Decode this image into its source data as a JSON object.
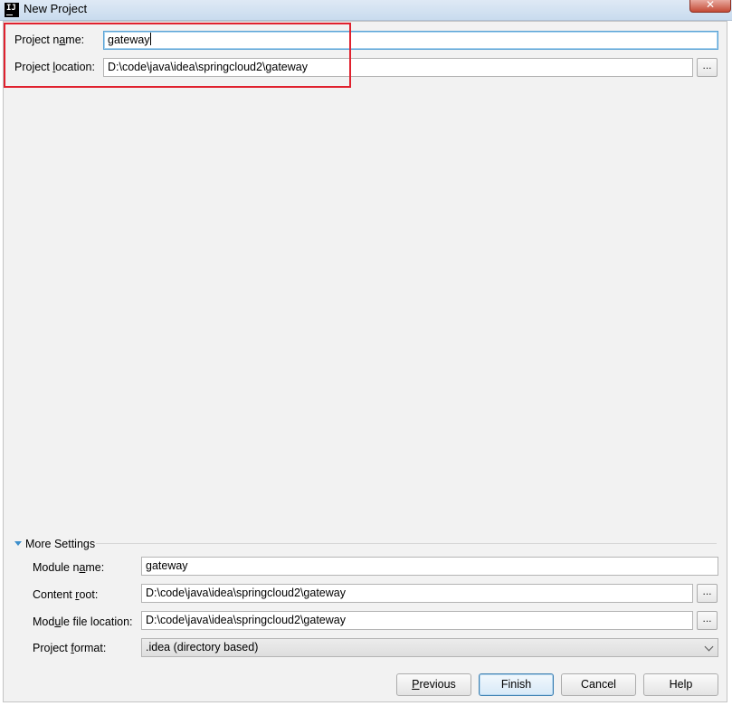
{
  "window": {
    "title": "New Project",
    "app_icon_label": "IJ",
    "close_symbol": "✕"
  },
  "project": {
    "name_label_pre": "Project n",
    "name_label_mn": "a",
    "name_label_post": "me:",
    "name_value": "gateway",
    "location_label_pre": "Project ",
    "location_label_mn": "l",
    "location_label_post": "ocation:",
    "location_value": "D:\\code\\java\\idea\\springcloud2\\gateway",
    "browse_label": "..."
  },
  "more_settings": {
    "title": "More Settings",
    "module_name_label_pre": "Module n",
    "module_name_label_mn": "a",
    "module_name_label_post": "me:",
    "module_name_value": "gateway",
    "content_root_label_pre": "Content ",
    "content_root_label_mn": "r",
    "content_root_label_post": "oot:",
    "content_root_value": "D:\\code\\java\\idea\\springcloud2\\gateway",
    "module_file_label_pre": "Mod",
    "module_file_label_mn": "u",
    "module_file_label_post": "le file location:",
    "module_file_value": "D:\\code\\java\\idea\\springcloud2\\gateway",
    "project_format_label_pre": "Project ",
    "project_format_label_mn": "f",
    "project_format_label_post": "ormat:",
    "project_format_value": ".idea (directory based)",
    "browse_label": "..."
  },
  "buttons": {
    "previous_mn": "P",
    "previous_rest": "revious",
    "finish": "Finish",
    "cancel": "Cancel",
    "help": "Help"
  },
  "colors": {
    "highlight_box": "#e0212e",
    "focus_border": "#5aa3d6",
    "primary_button_border": "#3c7fb1",
    "expand_arrow": "#3c8fcc"
  }
}
